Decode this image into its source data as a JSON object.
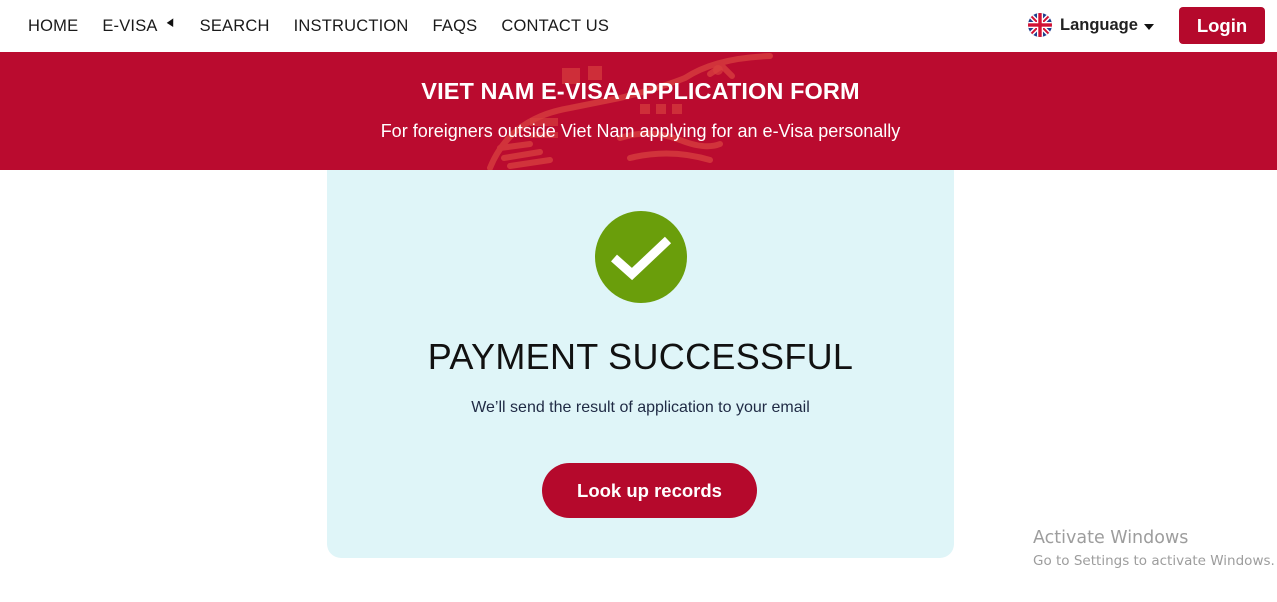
{
  "nav": {
    "items": [
      {
        "label": "HOME"
      },
      {
        "label": "E-VISA",
        "has_dropdown": true
      },
      {
        "label": "SEARCH"
      },
      {
        "label": "INSTRUCTION"
      },
      {
        "label": "FAQS"
      },
      {
        "label": "CONTACT US"
      }
    ],
    "language": {
      "label": "Language",
      "flag_icon": "uk-flag-icon"
    },
    "login_label": "Login"
  },
  "banner": {
    "title": "VIET NAM E-VISA APPLICATION FORM",
    "subtitle": "For foreigners outside Viet Nam applying for an e-Visa personally"
  },
  "result": {
    "icon": "check-circle-icon",
    "title": "PAYMENT SUCCESSFUL",
    "message": "We’ll send the result of application to your email",
    "button_label": "Look up records"
  },
  "watermark": {
    "title": "Activate Windows",
    "subtitle": "Go to Settings to activate Windows."
  },
  "colors": {
    "brand_red": "#ba0b2f",
    "button_red": "#b5092c",
    "success_green": "#6a9e0b",
    "card_bg": "#dff5f8"
  }
}
